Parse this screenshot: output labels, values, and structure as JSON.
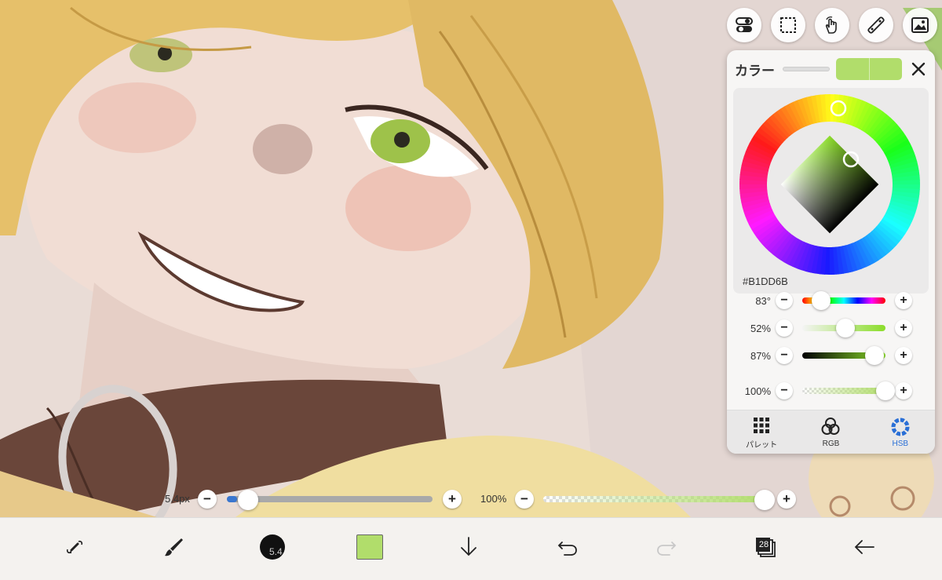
{
  "top_tools": [
    {
      "name": "layer-toggle-icon"
    },
    {
      "name": "selection-icon"
    },
    {
      "name": "hand-gesture-icon"
    },
    {
      "name": "ruler-icon"
    },
    {
      "name": "material-image-icon"
    }
  ],
  "color_panel": {
    "title": "カラー",
    "current_color": "#B1DD6B",
    "previous_color": "#B1DD6B",
    "hex_label": "#B1DD6B",
    "hue": {
      "label": "83°",
      "value": 0.23
    },
    "saturation": {
      "label": "52%",
      "value": 0.52
    },
    "brightness": {
      "label": "87%",
      "value": 0.87
    },
    "opacity": {
      "label": "100%",
      "value": 1.0
    },
    "tabs": [
      {
        "label": "パレット",
        "icon": "palette-grid-icon",
        "active": false
      },
      {
        "label": "RGB",
        "icon": "rgb-circles-icon",
        "active": false
      },
      {
        "label": "HSB",
        "icon": "hsb-ring-icon",
        "active": true
      }
    ]
  },
  "brush_size": {
    "label": "5.4px",
    "value": 0.05
  },
  "brush_opacity": {
    "label": "100%",
    "value": 1.0
  },
  "toolbar": {
    "brush_size_badge": "5.4",
    "layer_count": "28",
    "items": [
      "transform-tool-icon",
      "brush-tool-icon",
      "brush-size-icon",
      "color-swatch",
      "download-icon",
      "undo-icon",
      "redo-icon",
      "layers-icon",
      "back-arrow-icon"
    ]
  },
  "colors": {
    "accent": "#2a6fd6",
    "current": "#B1DD6B"
  }
}
